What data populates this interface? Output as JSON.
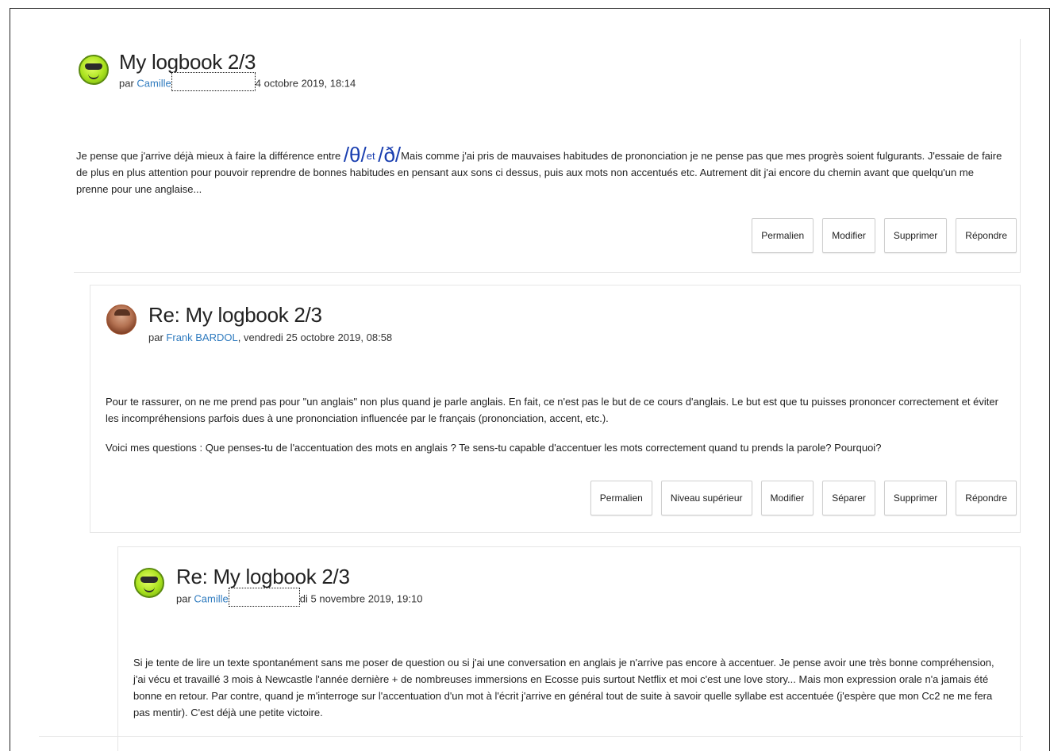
{
  "posts": [
    {
      "title": "My logbook 2/3",
      "by": "par",
      "author": "Camille",
      "date": "4 octobre 2019, 18:14",
      "body": {
        "part1": "Je pense que j'arrive déjà mieux à faire la différence entre ",
        "phon1": "/θ/",
        "and": "et",
        "phon2": "/ð/",
        "part2": "Mais comme j'ai pris de mauvaises habitudes de prononciation je ne pense pas que mes progrès soient fulgurants. J'essaie de faire de plus en plus attention pour pouvoir reprendre de bonnes habitudes en pensant aux sons ci dessus, puis aux mots non accentués etc. Autrement dit j'ai encore du chemin avant que quelqu'un me prenne pour une anglaise..."
      },
      "actions": [
        "Permalien",
        "Modifier",
        "Supprimer",
        "Répondre"
      ]
    },
    {
      "title": "Re: My logbook 2/3",
      "by": "par",
      "author": "Frank BARDOL",
      "date": ", vendredi 25 octobre 2019, 08:58",
      "paragraphs": [
        "Pour te rassurer, on ne me prend pas pour \"un anglais\" non plus quand je parle anglais. En fait, ce n'est pas le but de ce cours d'anglais. Le but est que tu puisses prononcer correctement et  éviter les incompréhensions parfois dues à une prononciation influencée par le français (prononciation, accent, etc.).",
        "Voici mes questions : Que penses-tu de l'accentuation des mots en anglais ? Te sens-tu capable d'accentuer les mots correctement quand tu prends la parole? Pourquoi?"
      ],
      "actions": [
        "Permalien",
        "Niveau supérieur",
        "Modifier",
        "Séparer",
        "Supprimer",
        "Répondre"
      ]
    },
    {
      "title": "Re: My logbook 2/3",
      "by": "par",
      "author": "Camille",
      "date": "di 5 novembre 2019, 19:10",
      "paragraphs": [
        "Si je tente de lire un texte spontanément sans me poser de question ou si j'ai une conversation en anglais je n'arrive pas encore à accentuer. Je pense avoir une très bonne compréhension, j'ai vécu et travaillé 3 mois à Newcastle l'année dernière + de nombreuses immersions en Ecosse puis surtout Netflix et moi c'est une love story... Mais mon expression orale n'a jamais été bonne en retour. Par contre, quand je m'interroge sur l'accentuation d'un mot à l'écrit j'arrive en général tout de suite à savoir quelle syllabe est accentuée (j'espère que mon Cc2 ne me fera pas mentir). C'est déjà une petite victoire."
      ]
    }
  ]
}
